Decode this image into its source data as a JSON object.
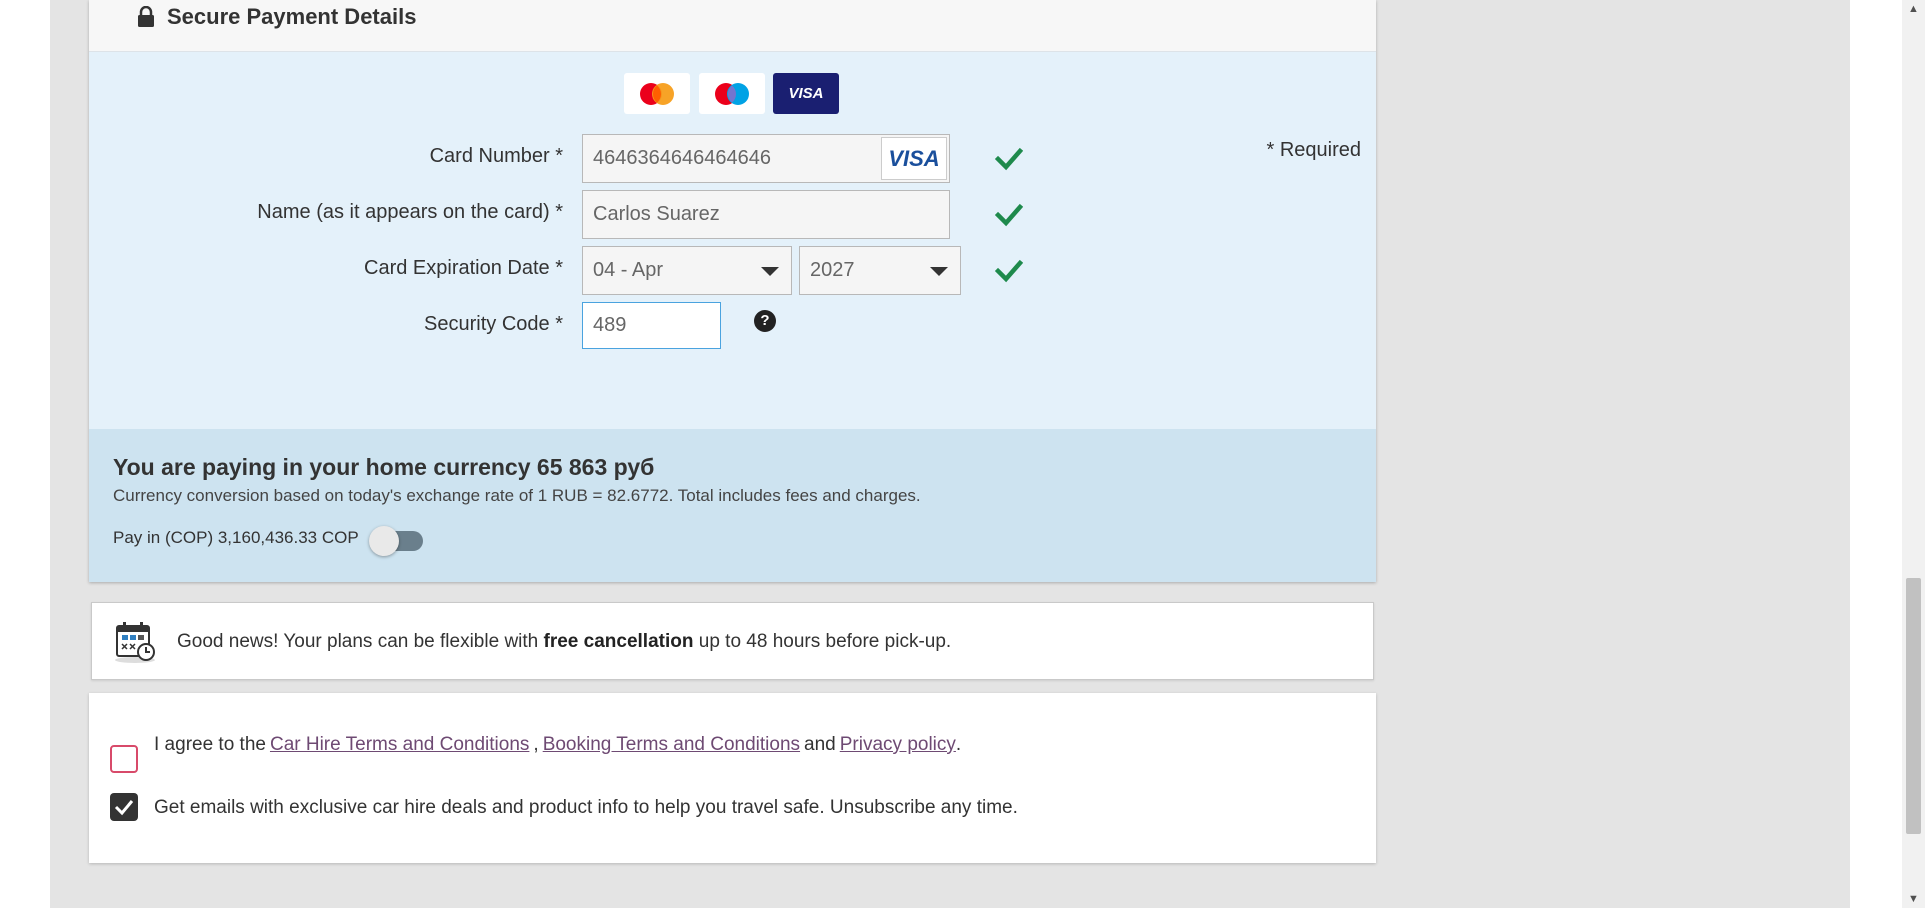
{
  "payment": {
    "title": "Secure Payment Details",
    "card_brands": [
      "mastercard",
      "maestro",
      "visa"
    ],
    "visa_label": "VISA",
    "required_note": "* Required",
    "card_number_label": "Card Number *",
    "card_number_value": "4646364646464646",
    "card_badge": "VISA",
    "name_label": "Name (as it appears on the card) *",
    "name_value": "Carlos Suarez",
    "expiry_label": "Card Expiration Date *",
    "expiry_month": "04 - Apr",
    "expiry_year": "2027",
    "security_label": "Security Code *",
    "security_value": "489",
    "help_glyph": "?",
    "valid_color": "#1e8a4c"
  },
  "currency": {
    "title": "You are paying in your home currency 65 863 руб",
    "description": "Currency conversion based on today's exchange rate of 1 RUB = 82.6772. Total includes fees and charges.",
    "pay_cop_label": "Pay in (COP) 3,160,436.33 COP",
    "toggle_on": false
  },
  "cancellation": {
    "prefix": "Good news! Your plans can be flexible with ",
    "bold": "free cancellation",
    "suffix": " up to 48 hours before pick-up."
  },
  "terms": {
    "agree_prefix": "I agree to the",
    "link1": "Car Hire Terms and Conditions",
    "sep": ",",
    "link2": "Booking Terms and Conditions",
    "and": "and",
    "link3": "Privacy policy",
    "period": ".",
    "agree_checked": false,
    "emails_text": "Get emails with exclusive car hire deals and product info to help you travel safe. Unsubscribe any time.",
    "emails_checked": true
  },
  "scrollbar": {
    "up_glyph": "▲",
    "down_glyph": "▼"
  }
}
